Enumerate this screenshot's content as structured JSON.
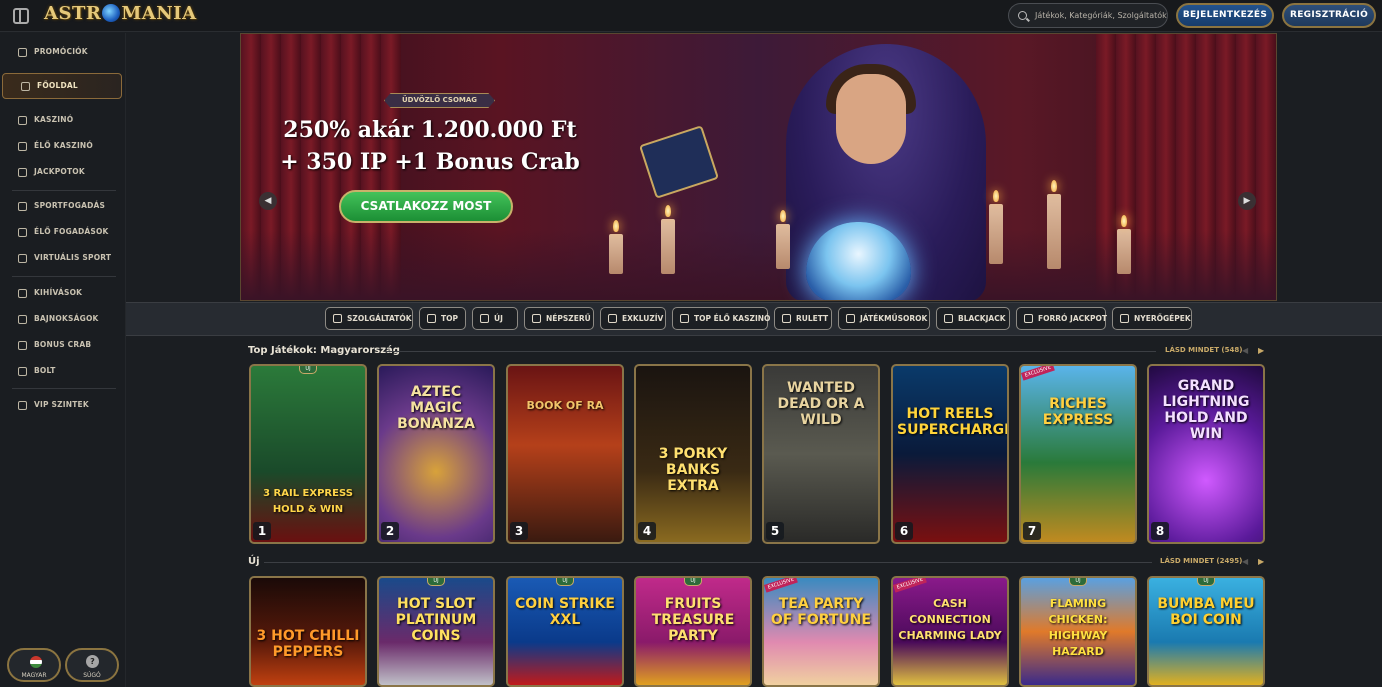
{
  "header": {
    "logo": "ASTROMANIA",
    "search_placeholder": "Játékok, Kategóriák, Szolgáltatók",
    "login_label": "BEJELENTKEZÉS",
    "register_label": "REGISZTRÁCIÓ"
  },
  "sidebar": {
    "items": [
      {
        "label": "PROMÓCIÓK",
        "icon": "gift-icon"
      },
      {
        "label": "FŐOLDAL",
        "icon": "home-icon"
      },
      {
        "label": "KASZINÓ",
        "icon": "casino-chip-icon"
      },
      {
        "label": "ÉLŐ KASZINÓ",
        "icon": "cards-icon"
      },
      {
        "label": "JACKPOTOK",
        "icon": "clover-icon"
      },
      {
        "label": "SPORTFOGADÁS",
        "icon": "soccer-ball-icon"
      },
      {
        "label": "ÉLŐ FOGADÁSOK",
        "icon": "live-tv-icon"
      },
      {
        "label": "VIRTUÁLIS SPORT",
        "icon": "virtual-sport-icon"
      },
      {
        "label": "KIHÍVÁSOK",
        "icon": "challenge-icon"
      },
      {
        "label": "BAJNOKSÁGOK",
        "icon": "trophy-icon"
      },
      {
        "label": "BONUS CRAB",
        "icon": "crab-icon"
      },
      {
        "label": "BOLT",
        "icon": "shop-icon"
      },
      {
        "label": "VIP SZINTEK",
        "icon": "vip-icon"
      }
    ],
    "language_label": "MAGYAR",
    "help_label": "SÚGÓ",
    "help_glyph": "?"
  },
  "banner": {
    "badge": "ÜDVÖZLŐ CSOMAG",
    "headline_line1": "250% akár 1.200.000 Ft",
    "headline_line2": "+ 350 IP +1 Bonus Crab",
    "cta": "CSATLAKOZZ MOST",
    "prev_glyph": "◀",
    "next_glyph": "▶"
  },
  "categories": [
    "SZOLGÁLTATÓK",
    "TOP",
    "ÚJ",
    "NÉPSZERŰ",
    "EXKLUZÍV",
    "TOP ÉLŐ KASZINÓ",
    "RULETT",
    "JÁTÉKMŰSOROK",
    "BLACKJACK",
    "FORRÓ JACKPOT",
    "NYERŐGÉPEK"
  ],
  "top_games": {
    "title": "Top Játékok: Magyarország",
    "see_all": "LÁSD MINDET (548)",
    "games": [
      {
        "name": "3 RAIL EXPRESS HOLD & WIN",
        "rank": "1",
        "badge": "ÚJ"
      },
      {
        "name": "AZTEC MAGIC BONANZA",
        "rank": "2",
        "badge": ""
      },
      {
        "name": "BOOK OF RA",
        "rank": "3",
        "badge": ""
      },
      {
        "name": "3 PORKY BANKS EXTRA",
        "rank": "4",
        "badge": ""
      },
      {
        "name": "WANTED DEAD OR A WILD",
        "rank": "5",
        "badge": ""
      },
      {
        "name": "HOT REELS SUPERCHARGED",
        "rank": "6",
        "badge": ""
      },
      {
        "name": "RICHES EXPRESS",
        "rank": "7",
        "badge": "EXCLUSIVE"
      },
      {
        "name": "GRAND LIGHTNING HOLD AND WIN",
        "rank": "8",
        "badge": ""
      }
    ]
  },
  "new_games": {
    "title": "Új",
    "see_all": "LÁSD MINDET (2495)",
    "games": [
      {
        "name": "3 HOT CHILLI PEPPERS",
        "badge": ""
      },
      {
        "name": "HOT SLOT PLATINUM COINS",
        "badge": "ÚJ"
      },
      {
        "name": "COIN STRIKE XXL",
        "badge": "ÚJ"
      },
      {
        "name": "FRUITS TREASURE PARTY",
        "badge": "ÚJ"
      },
      {
        "name": "TEA PARTY OF FORTUNE",
        "badge": "EXCLUSIVE"
      },
      {
        "name": "CASH CONNECTION CHARMING LADY",
        "badge": "EXCLUSIVE"
      },
      {
        "name": "FLAMING CHICKEN: HIGHWAY HAZARD",
        "badge": "ÚJ"
      },
      {
        "name": "BUMBA MEU BOI COIN",
        "badge": "ÚJ"
      }
    ]
  },
  "colors": {
    "accent_gold": "#c8a968",
    "cta_green": "#2ea846",
    "login_blue": "#1e4a80"
  }
}
